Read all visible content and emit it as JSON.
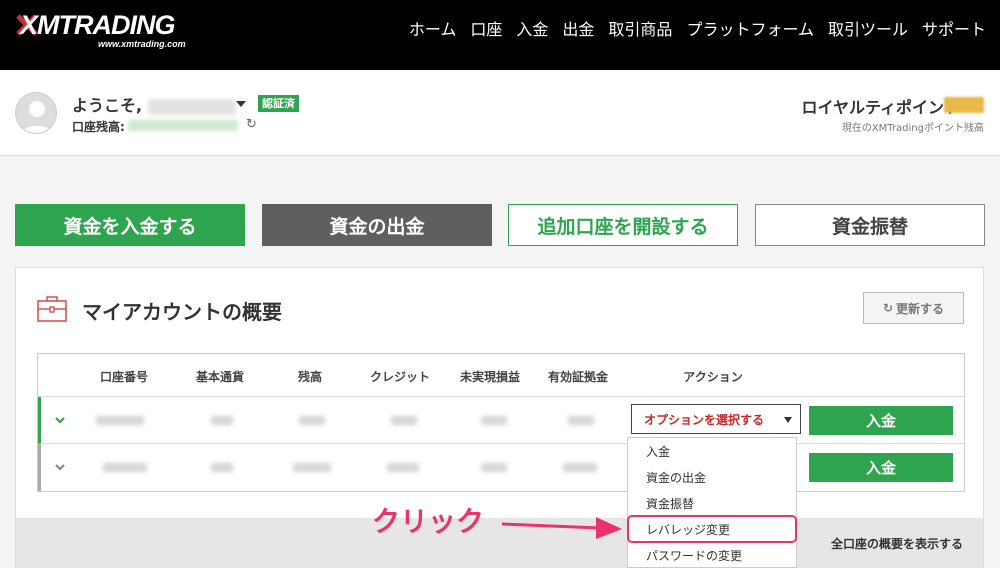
{
  "header": {
    "logo_text": "XMTRADING",
    "logo_url_text": "www.xmtrading.com",
    "nav": [
      "ホーム",
      "口座",
      "入金",
      "出金",
      "取引商品",
      "プラットフォーム",
      "取引ツール",
      "サポート"
    ]
  },
  "user": {
    "welcome": "ようこそ,",
    "verified_badge": "認証済",
    "balance_label": "口座残高:",
    "loyalty_title": "ロイヤルティポイント",
    "loyalty_sub": "現在のXMTradingポイント残高"
  },
  "actions": {
    "deposit": "資金を入金する",
    "withdraw": "資金の出金",
    "open_account": "追加口座を開設する",
    "transfer": "資金振替"
  },
  "overview": {
    "title": "マイアカウントの概要",
    "refresh": "更新する",
    "columns": [
      "口座番号",
      "基本通貨",
      "残高",
      "クレジット",
      "未実現損益",
      "有効証拠金",
      "アクション"
    ],
    "select_placeholder": "オプションを選択する",
    "row_deposit": "入金",
    "show_all": "全口座の概要を表示する"
  },
  "dropdown": {
    "items": [
      "入金",
      "資金の出金",
      "資金振替",
      "レバレッジ変更",
      "パスワードの変更"
    ],
    "highlighted": "レバレッジ変更"
  },
  "annotation": {
    "text": "クリック",
    "color": "#e8336b"
  },
  "colors": {
    "brand_green": "#2ea44f",
    "header_bg": "#000000",
    "select_text": "#c62828"
  }
}
